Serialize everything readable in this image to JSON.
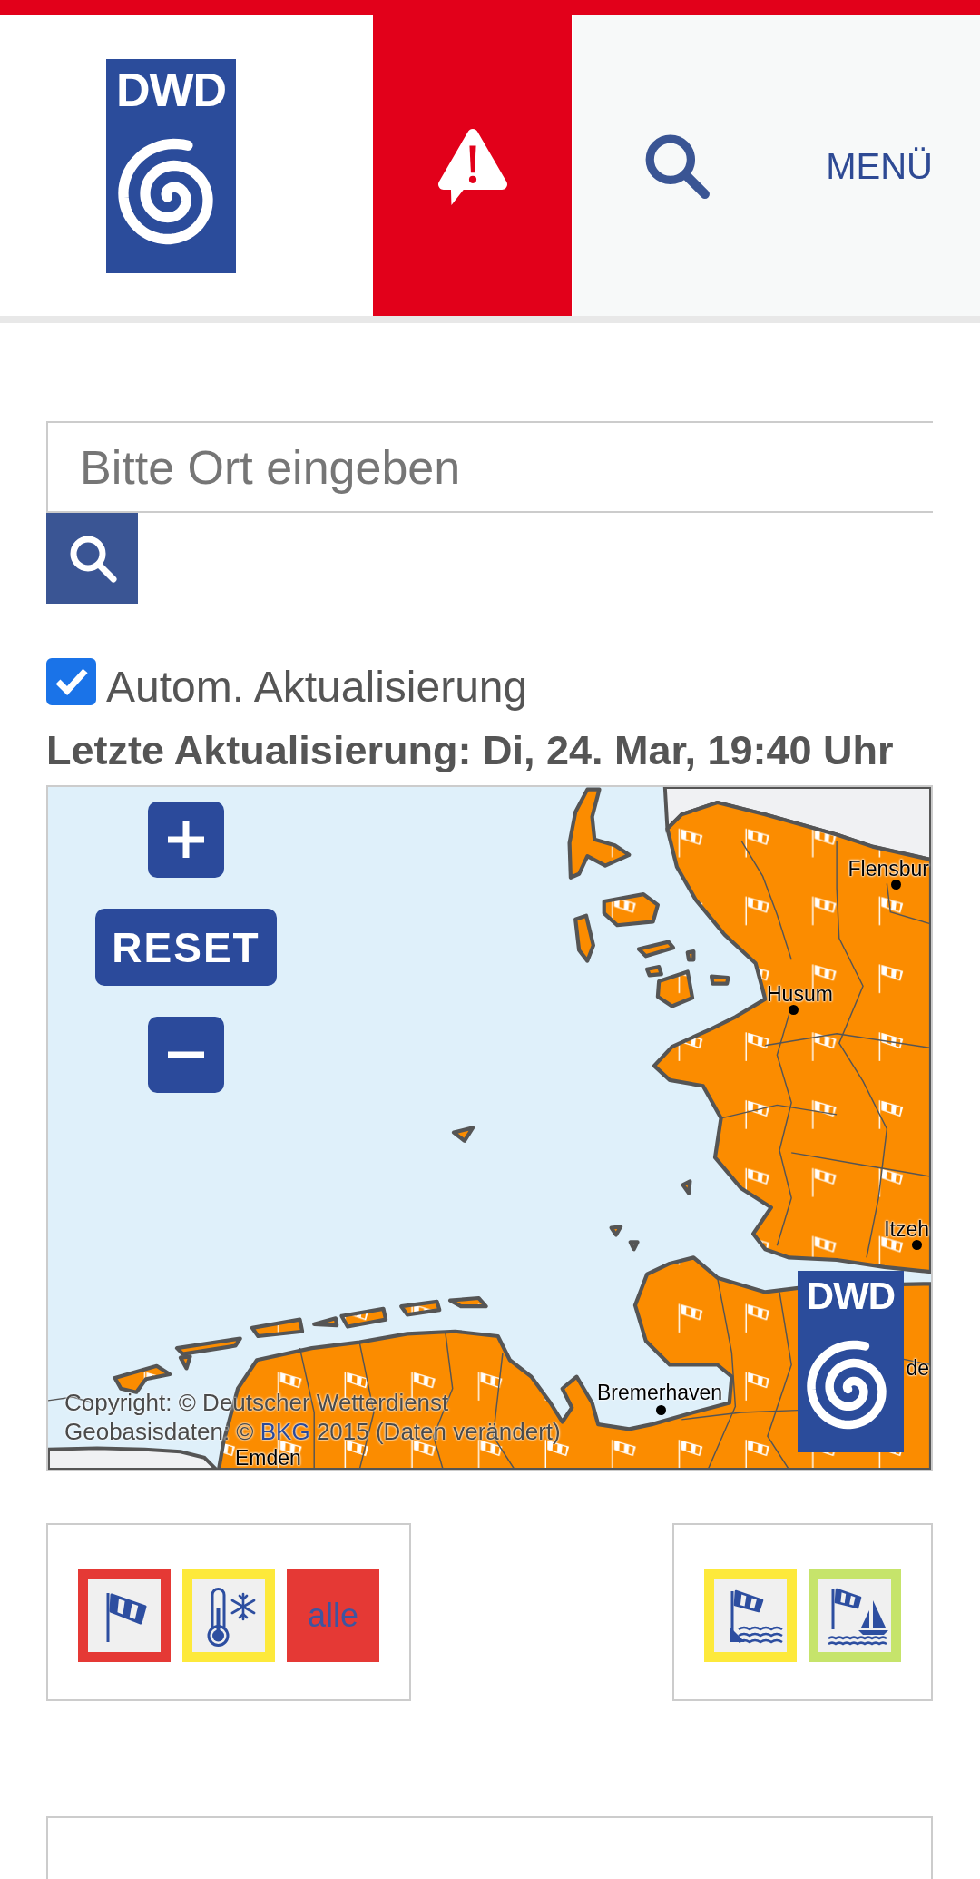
{
  "header": {
    "logo_text": "DWD",
    "menu_label": "MENÜ"
  },
  "search": {
    "placeholder": "Bitte Ort eingeben"
  },
  "auto_update": {
    "label": "Autom. Aktualisierung",
    "checked": true
  },
  "last_update": "Letzte Aktualisierung: Di, 24. Mar, 19:40 Uhr",
  "map": {
    "controls": [
      {
        "kind": "zoom_in"
      },
      {
        "kind": "reset",
        "label": "RESET"
      },
      {
        "kind": "zoom_out"
      }
    ],
    "places": [
      {
        "name": "Flensbur",
        "dot": true
      },
      {
        "name": "Husum",
        "dot": true
      },
      {
        "name": "Itzeh",
        "dot": true
      },
      {
        "name": "de",
        "dot": false
      },
      {
        "name": "Bremerhaven",
        "dot": true
      },
      {
        "name": "Emden",
        "dot": false
      }
    ],
    "copyright": "Copyright: © Deutscher Wetterdienst",
    "attribution": {
      "before": "Geobasisdaten: © ",
      "link": "BKG",
      "after": " 2015 (Daten verändert)"
    },
    "logo_text": "DWD"
  },
  "filter_groups": [
    {
      "items": [
        {
          "kind": "wind",
          "color": "#e53935"
        },
        {
          "kind": "frost",
          "color": "#fde93b"
        },
        {
          "kind": "all",
          "label": "alle",
          "color": "#e53935"
        }
      ]
    },
    {
      "items": [
        {
          "kind": "storm_surge",
          "color": "#fde93b"
        },
        {
          "kind": "sea_wind",
          "color": "#c6e46b"
        }
      ]
    }
  ]
}
